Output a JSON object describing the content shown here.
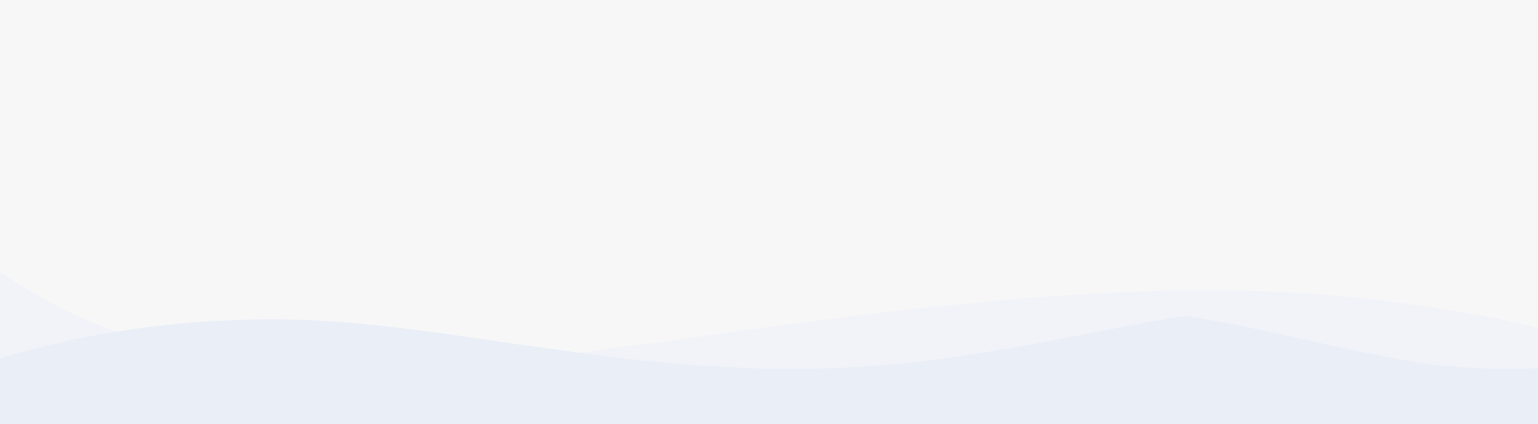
{
  "page": {
    "background_color": "#f7f7f8"
  },
  "waves": {
    "back_wave_color": "#f1f3f8",
    "front_wave_color": "#e9eef7"
  }
}
